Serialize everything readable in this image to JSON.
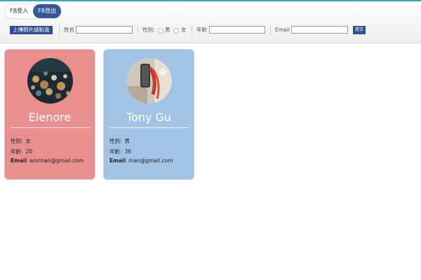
{
  "fb": {
    "login_label": "FB登入",
    "logout_label": "FB登出"
  },
  "form": {
    "upload_label": "上傳照片請點我",
    "name_label": "姓名",
    "name_value": "",
    "gender_label": "性別:",
    "gender_options": [
      "男",
      "女"
    ],
    "age_label": "年齡",
    "age_value": "",
    "email_label": "Email",
    "email_value": "",
    "submit_label": "提交"
  },
  "cards": [
    {
      "name": "Elenore",
      "gender_label": "性別:",
      "gender": "女",
      "age_label": "年齡:",
      "age": "20",
      "email_label": "Email",
      "email": "worman@gmail.com",
      "color": "#e98f8f"
    },
    {
      "name": "Tony Gu",
      "gender_label": "性別:",
      "gender": "男",
      "age_label": "年齡:",
      "age": "36",
      "email_label": "Email",
      "email": "man@gmail.com",
      "color": "#a1c4e6"
    }
  ]
}
